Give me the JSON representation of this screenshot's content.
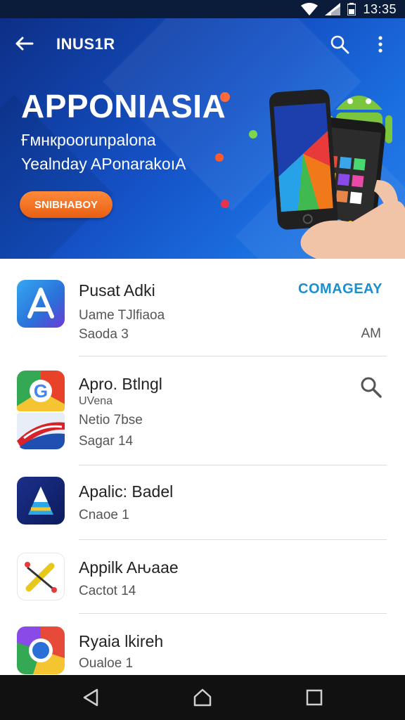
{
  "status_bar": {
    "time": "13:35",
    "icons": [
      "wifi-icon",
      "signal-icon",
      "battery-icon"
    ]
  },
  "toolbar": {
    "title": "INUS1R",
    "icons": [
      "back-arrow-icon",
      "search-icon",
      "more-vert-icon"
    ]
  },
  "hero": {
    "title": "APPONIASIA",
    "subtitle_line1": "Ғмнкрoorunpalona",
    "subtitle_line2": "Yealnday APonarakoıA",
    "cta_label": "SNIBHABOY"
  },
  "apps": [
    {
      "name": "Pusat Adki",
      "line1": "Uame TJlfiaoa",
      "line2": "Saoda 3",
      "action_label": "COMAGEAY",
      "meta": "AM"
    },
    {
      "name": "Apro. Btlngl",
      "line1": "UVena",
      "line2": "Netio 7bse",
      "line3": "Sagar 14",
      "action_icons": [
        "search-icon",
        "checkbox-icon"
      ]
    },
    {
      "name": "Apalic: Badel",
      "line1": "Cnaoe 1",
      "action_icon": "square-dot-icon"
    },
    {
      "name": "Appilk Aԋaae",
      "line1": "Cactot 14",
      "action_icon": "square-dot-icon"
    },
    {
      "name": "Ryaia lkireh",
      "line1": "Oualoe 1",
      "action_icon": "square-dot-icon"
    }
  ],
  "nav_bar": {
    "icons": [
      "back-triangle-icon",
      "home-icon",
      "recents-icon"
    ]
  },
  "colors": {
    "hero_start": "#0d2f86",
    "hero_end": "#2a7fea",
    "accent_link": "#1a8fcf",
    "cta": "#e85f12"
  }
}
